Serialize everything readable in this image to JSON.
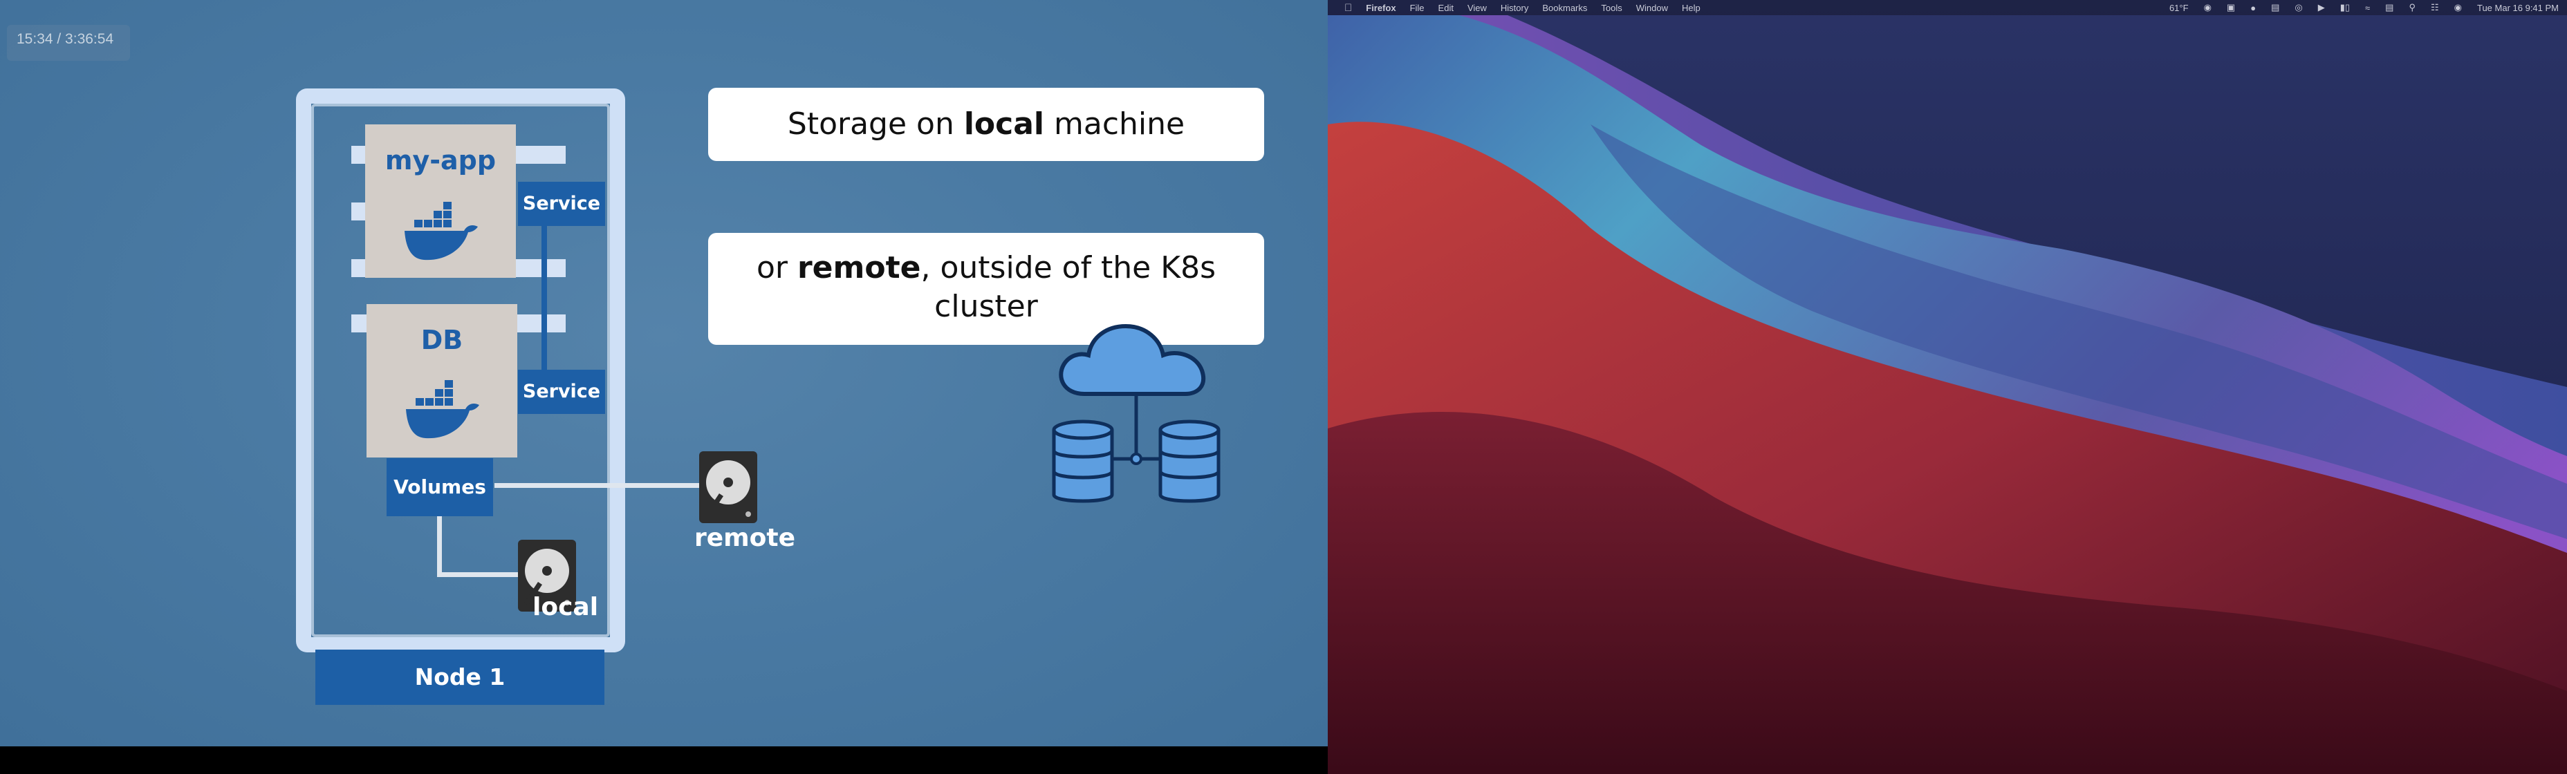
{
  "video": {
    "timestamp": "15:34 / 3:36:54",
    "card_local": {
      "pre": "Storage on ",
      "bold": "local",
      "post": " machine"
    },
    "card_remote": {
      "pre": "or ",
      "bold": "remote",
      "post": ", outside of the K8s cluster"
    },
    "pod_app": "my-app",
    "pod_db": "DB",
    "service": "Service",
    "volumes": "Volumes",
    "disk_remote": "remote",
    "disk_local": "local",
    "node": "Node 1"
  },
  "menubar": {
    "app": "Firefox",
    "menus": [
      "File",
      "Edit",
      "View",
      "History",
      "Bookmarks",
      "Tools",
      "Window",
      "Help"
    ],
    "status_text": "61°F",
    "clock": "Tue Mar 16  9:41 PM"
  },
  "colors": {
    "slide_bg": "#4a7aa3",
    "k8s_blue": "#1d5fa6",
    "node_frame": "#cfe0f6",
    "pod_bg": "#d3cdc8"
  }
}
